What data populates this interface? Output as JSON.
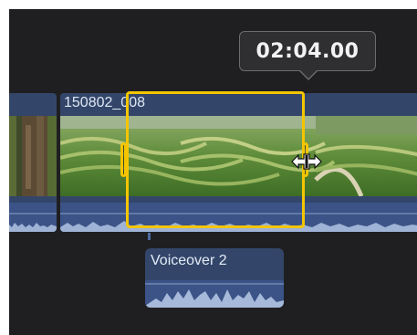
{
  "timecode": {
    "value": "02:04.00"
  },
  "clips": {
    "main_clip": {
      "title": "150802_008"
    }
  },
  "voiceover": {
    "title": "Voiceover 2"
  },
  "colors": {
    "selection": "#f3c500",
    "clip_bg": "#33466a",
    "timeline_bg": "#1f1f21"
  },
  "icons": {
    "cursor": "resize-horizontal-icon"
  }
}
